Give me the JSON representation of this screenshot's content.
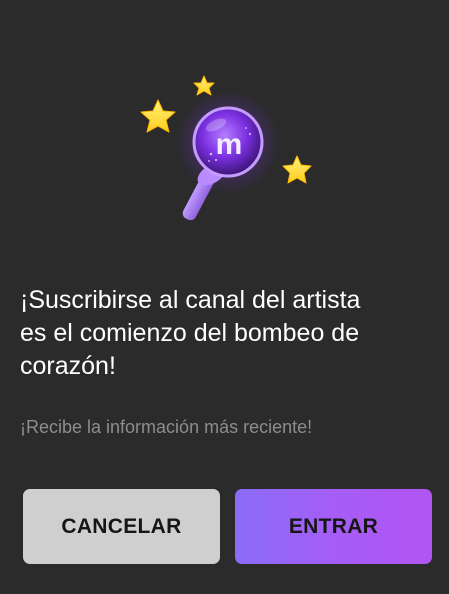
{
  "dialog": {
    "headline": "¡Suscribirse al canal del artista\nes el comienzo del bombeo de\ncorazón!",
    "subtext": "¡Recibe la información más reciente!",
    "illustration_icon": "lightstick-with-stars-icon",
    "lightstick_letter": "m"
  },
  "buttons": {
    "cancel_label": "CANCELAR",
    "enter_label": "ENTRAR"
  },
  "colors": {
    "background": "#2b2b2b",
    "headline": "#ffffff",
    "subtext": "#8d8d8d",
    "cancel_bg": "#cfcfcf",
    "enter_bg_start": "#8b6cf7",
    "enter_bg_end": "#b155f2",
    "star": "#ffe74a",
    "orb": "#8a3df2"
  }
}
